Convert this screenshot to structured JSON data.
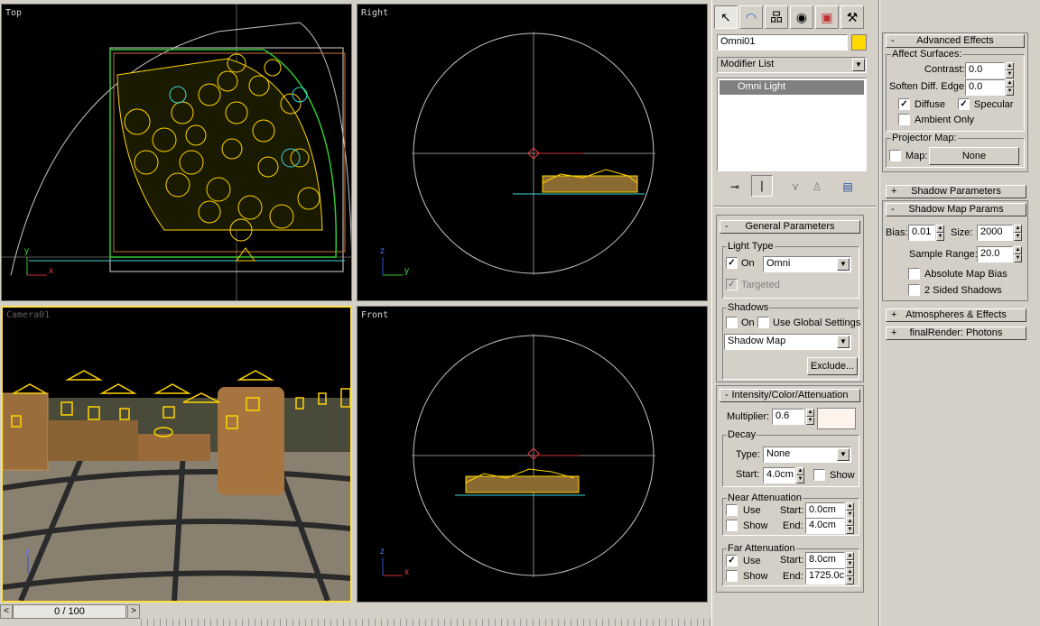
{
  "viewports": {
    "top": {
      "label": "Top",
      "axis_h": "x",
      "axis_v": "y"
    },
    "right": {
      "label": "Right",
      "axis_h": "y",
      "axis_v": "z"
    },
    "camera": {
      "label": "Camera01",
      "axis_v": "z"
    },
    "front": {
      "label": "Front",
      "axis_h": "x",
      "axis_v": "z"
    }
  },
  "timeline": {
    "frame_label": "0 / 100",
    "prev": "<",
    "next": ">"
  },
  "create_tabs": [
    "create-icon",
    "modify-icon",
    "hierarchy-icon",
    "motion-icon",
    "display-icon",
    "utilities-icon"
  ],
  "object": {
    "name": "Omni01",
    "color": "#ffd800"
  },
  "modifier_list": {
    "label": "Modifier List",
    "stack_item": "Omni Light"
  },
  "general": {
    "title": "General Parameters",
    "light_type_group": "Light Type",
    "on_label": "On",
    "on_checked": true,
    "type_value": "Omni",
    "targeted_label": "Targeted",
    "shadows_group": "Shadows",
    "shadows_on_label": "On",
    "use_global_label": "Use Global Settings",
    "shadow_type": "Shadow Map",
    "exclude_label": "Exclude..."
  },
  "intensity": {
    "title": "Intensity/Color/Attenuation",
    "multiplier_label": "Multiplier:",
    "multiplier_value": "0.6",
    "swatch_color": "#fdf3ea",
    "decay_group": "Decay",
    "type_label": "Type:",
    "type_value": "None",
    "start_label": "Start:",
    "start_value": "4.0cm",
    "show_label": "Show",
    "near_group": "Near Attenuation",
    "near_use": "Use",
    "near_show": "Show",
    "near_start_label": "Start:",
    "near_start": "0.0cm",
    "near_end_label": "End:",
    "near_end": "4.0cm",
    "far_group": "Far Attenuation",
    "far_use": "Use",
    "far_use_checked": true,
    "far_show": "Show",
    "far_start_label": "Start:",
    "far_start": "8.0cm",
    "far_end_label": "End:",
    "far_end": "1725.0c"
  },
  "advanced": {
    "title": "Advanced Effects",
    "affect_group": "Affect Surfaces:",
    "contrast_label": "Contrast:",
    "contrast_value": "0.0",
    "soften_label": "Soften Diff. Edge:",
    "soften_value": "0.0",
    "diffuse_label": "Diffuse",
    "specular_label": "Specular",
    "ambient_label": "Ambient Only",
    "projector_group": "Projector Map:",
    "map_label": "Map:",
    "map_value": "None"
  },
  "shadow_params": {
    "title": "Shadow Parameters"
  },
  "shadow_map": {
    "title": "Shadow Map Params",
    "bias_label": "Bias:",
    "bias_value": "0.01",
    "size_label": "Size:",
    "size_value": "2000",
    "range_label": "Sample Range:",
    "range_value": "20.0",
    "absolute_label": "Absolute Map Bias",
    "two_sided_label": "2 Sided Shadows"
  },
  "atmospheres": {
    "title": "Atmospheres & Effects"
  },
  "final_render": {
    "title": "finalRender: Photons"
  },
  "rollout_signs": {
    "minus": "-",
    "plus": "+"
  }
}
